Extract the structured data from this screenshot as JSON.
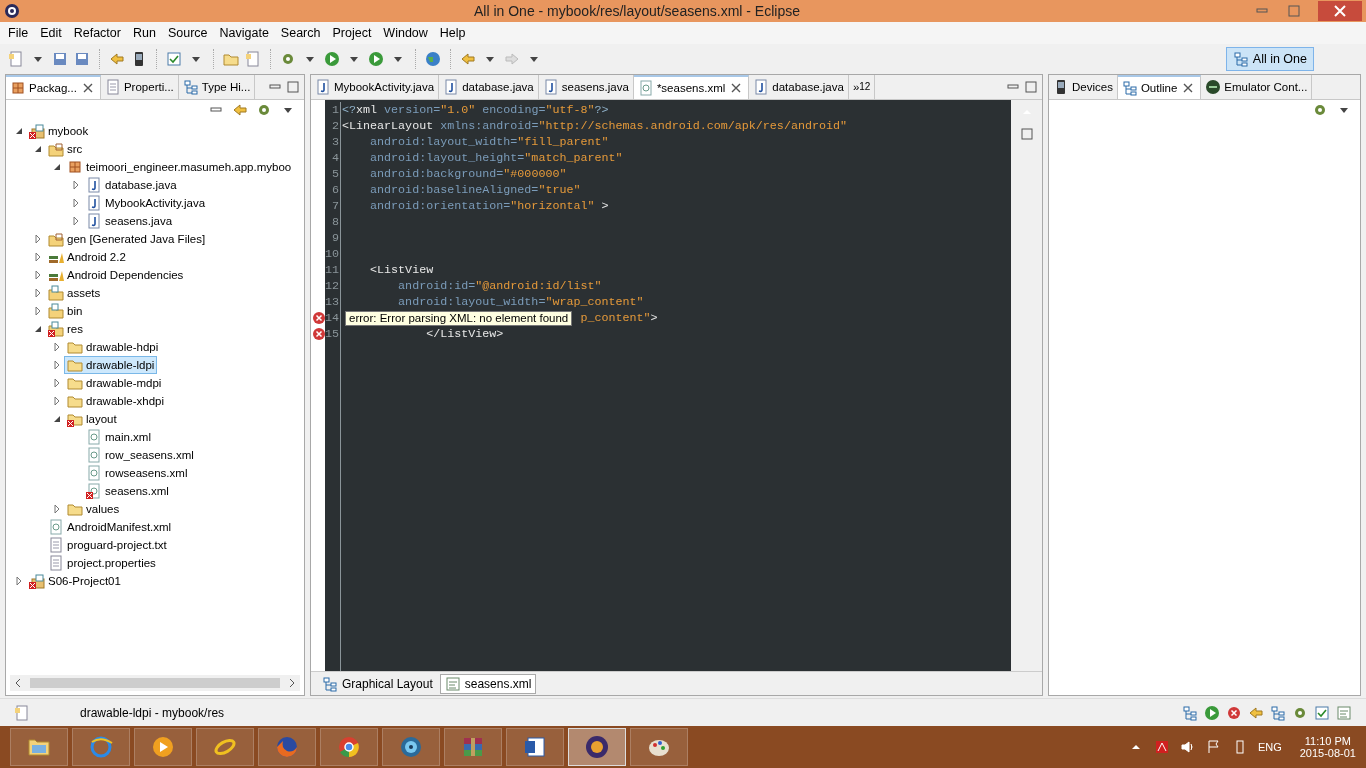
{
  "window": {
    "title": "All in One - mybook/res/layout/seasens.xml - Eclipse"
  },
  "menu": [
    "File",
    "Edit",
    "Refactor",
    "Run",
    "Source",
    "Navigate",
    "Search",
    "Project",
    "Window",
    "Help"
  ],
  "perspective": {
    "label": "All in One",
    "selected": true
  },
  "left_panel": {
    "tabs": [
      {
        "label": "Packag...",
        "selected": true,
        "closable": true
      },
      {
        "label": "Properti...",
        "selected": false,
        "closable": false
      },
      {
        "label": "Type Hi...",
        "selected": false,
        "closable": false
      }
    ],
    "tree": [
      {
        "label": "mybook",
        "kind": "project",
        "error": true,
        "expanded": true,
        "selected": false,
        "children": [
          {
            "label": "src",
            "kind": "srcfolder",
            "error": false,
            "expanded": true,
            "selected": false,
            "children": [
              {
                "label": "teimoori_engineer.masumeh.app.myboo",
                "kind": "package",
                "error": false,
                "expanded": true,
                "selected": false,
                "children": [
                  {
                    "label": "database.java",
                    "kind": "java",
                    "error": false,
                    "expanded": false,
                    "selected": false
                  },
                  {
                    "label": "MybookActivity.java",
                    "kind": "java",
                    "error": false,
                    "expanded": false,
                    "selected": false
                  },
                  {
                    "label": "seasens.java",
                    "kind": "java",
                    "error": false,
                    "expanded": false,
                    "selected": false
                  }
                ]
              }
            ]
          },
          {
            "label": "gen [Generated Java Files]",
            "kind": "srcfolder",
            "error": false,
            "expanded": false,
            "selected": false
          },
          {
            "label": "Android 2.2",
            "kind": "library",
            "error": false,
            "expanded": false,
            "selected": false
          },
          {
            "label": "Android Dependencies",
            "kind": "library",
            "error": false,
            "expanded": false,
            "selected": false
          },
          {
            "label": "assets",
            "kind": "resfolder",
            "error": false,
            "expanded": false,
            "selected": false
          },
          {
            "label": "bin",
            "kind": "resfolder",
            "error": false,
            "expanded": false,
            "selected": false
          },
          {
            "label": "res",
            "kind": "resfolder",
            "error": true,
            "expanded": true,
            "selected": false,
            "children": [
              {
                "label": "drawable-hdpi",
                "kind": "folder",
                "error": false,
                "expanded": false,
                "selected": false
              },
              {
                "label": "drawable-ldpi",
                "kind": "folder",
                "error": false,
                "expanded": false,
                "selected": true
              },
              {
                "label": "drawable-mdpi",
                "kind": "folder",
                "error": false,
                "expanded": false,
                "selected": false
              },
              {
                "label": "drawable-xhdpi",
                "kind": "folder",
                "error": false,
                "expanded": false,
                "selected": false
              },
              {
                "label": "layout",
                "kind": "folder",
                "error": true,
                "expanded": true,
                "selected": false,
                "children": [
                  {
                    "label": "main.xml",
                    "kind": "xml",
                    "error": false,
                    "selected": false
                  },
                  {
                    "label": "row_seasens.xml",
                    "kind": "xml",
                    "error": false,
                    "selected": false
                  },
                  {
                    "label": "rowseasens.xml",
                    "kind": "xml",
                    "error": false,
                    "selected": false
                  },
                  {
                    "label": "seasens.xml",
                    "kind": "xml",
                    "error": true,
                    "selected": false
                  }
                ]
              },
              {
                "label": "values",
                "kind": "folder",
                "error": false,
                "expanded": false,
                "selected": false
              }
            ]
          },
          {
            "label": "AndroidManifest.xml",
            "kind": "xml",
            "error": false,
            "selected": false
          },
          {
            "label": "proguard-project.txt",
            "kind": "file",
            "error": false,
            "selected": false
          },
          {
            "label": "project.properties",
            "kind": "file",
            "error": false,
            "selected": false
          }
        ]
      },
      {
        "label": "S06-Project01",
        "kind": "project",
        "error": true,
        "expanded": false,
        "selected": false
      }
    ]
  },
  "editor": {
    "tabs": [
      {
        "label": "MybookActivity.java",
        "kind": "java",
        "selected": false,
        "closable": false
      },
      {
        "label": "database.java",
        "kind": "java",
        "selected": false,
        "closable": false
      },
      {
        "label": "seasens.java",
        "kind": "java",
        "selected": false,
        "closable": false
      },
      {
        "label": "*seasens.xml",
        "kind": "xml",
        "selected": true,
        "closable": true
      },
      {
        "label": "database.java",
        "kind": "java",
        "selected": false,
        "closable": false
      }
    ],
    "overflow": {
      "symbol": "»",
      "count": "12"
    },
    "lines": [
      {
        "number": "1",
        "error": false,
        "tokens": [
          {
            "kind": "punct",
            "text": "<?"
          },
          {
            "kind": "tag",
            "text": "xml"
          },
          {
            "kind": "attr",
            "text": " version="
          },
          {
            "kind": "value",
            "text": "\"1.0\""
          },
          {
            "kind": "attr",
            "text": " encoding="
          },
          {
            "kind": "value",
            "text": "\"utf-8\""
          },
          {
            "kind": "punct",
            "text": "?>"
          }
        ]
      },
      {
        "number": "2",
        "error": false,
        "tokens": [
          {
            "kind": "tag",
            "text": "<LinearLayout"
          },
          {
            "kind": "attr",
            "text": " xmlns:android="
          },
          {
            "kind": "value",
            "text": "\"http://schemas.android.com/apk/res/android\""
          }
        ]
      },
      {
        "number": "3",
        "error": false,
        "tokens": [
          {
            "kind": "attr",
            "text": "    android:layout_width="
          },
          {
            "kind": "value",
            "text": "\"fill_parent\""
          }
        ]
      },
      {
        "number": "4",
        "error": false,
        "tokens": [
          {
            "kind": "attr",
            "text": "    android:layout_height="
          },
          {
            "kind": "value",
            "text": "\"match_parent\""
          }
        ]
      },
      {
        "number": "5",
        "error": false,
        "tokens": [
          {
            "kind": "attr",
            "text": "    android:background="
          },
          {
            "kind": "value",
            "text": "\"#000000\""
          }
        ]
      },
      {
        "number": "6",
        "error": false,
        "tokens": [
          {
            "kind": "attr",
            "text": "    android:baselineAligned="
          },
          {
            "kind": "value",
            "text": "\"true\""
          }
        ]
      },
      {
        "number": "7",
        "error": false,
        "tokens": [
          {
            "kind": "attr",
            "text": "    android:orientation="
          },
          {
            "kind": "value",
            "text": "\"horizontal\""
          },
          {
            "kind": "tag",
            "text": " >"
          }
        ]
      },
      {
        "number": "8",
        "error": false
      },
      {
        "number": "9",
        "error": false
      },
      {
        "number": "10",
        "error": false
      },
      {
        "number": "11",
        "error": false,
        "tokens": [
          {
            "kind": "tag",
            "text": "    <ListView"
          }
        ]
      },
      {
        "number": "12",
        "error": false,
        "tokens": [
          {
            "kind": "attr",
            "text": "        android:id="
          },
          {
            "kind": "value",
            "text": "\"@android:id/list\""
          }
        ]
      },
      {
        "number": "13",
        "error": false,
        "tokens": [
          {
            "kind": "attr",
            "text": "        android:layout_width="
          },
          {
            "kind": "value",
            "text": "\"wrap_content\""
          }
        ]
      },
      {
        "number": "14",
        "error": true,
        "tooltip": "error: Error parsing XML: no element found",
        "tokens": [
          {
            "kind": "value",
            "text": "p_content\""
          },
          {
            "kind": "tag",
            "text": ">"
          }
        ]
      },
      {
        "number": "15",
        "error": true,
        "tokens": [
          {
            "kind": "tag",
            "text": "            </ListView>"
          }
        ]
      }
    ],
    "bottom_tabs": [
      {
        "label": "Graphical Layout",
        "kind": "layout",
        "selected": false
      },
      {
        "label": "seasens.xml",
        "kind": "source",
        "selected": true
      }
    ]
  },
  "right_panel": {
    "tabs": [
      {
        "label": "Devices",
        "kind": "phone",
        "selected": false,
        "closable": false
      },
      {
        "label": "Outline",
        "kind": "outline",
        "selected": true,
        "closable": true
      },
      {
        "label": "Emulator Cont...",
        "kind": "emulator",
        "selected": false,
        "closable": false
      }
    ]
  },
  "status_bar": {
    "text": "drawable-ldpi - mybook/res"
  },
  "taskbar": {
    "apps": [
      {
        "kind": "explorer",
        "selected": false
      },
      {
        "kind": "ie",
        "selected": false
      },
      {
        "kind": "player",
        "selected": false
      },
      {
        "kind": "ring",
        "selected": false
      },
      {
        "kind": "firefox",
        "selected": false
      },
      {
        "kind": "chrome",
        "selected": false
      },
      {
        "kind": "disc",
        "selected": false
      },
      {
        "kind": "archive",
        "selected": false
      },
      {
        "kind": "word",
        "selected": false
      },
      {
        "kind": "ide",
        "selected": true
      },
      {
        "kind": "paint",
        "selected": false
      }
    ],
    "language": "ENG",
    "time": "11:10 PM",
    "date": "2015-08-01"
  }
}
